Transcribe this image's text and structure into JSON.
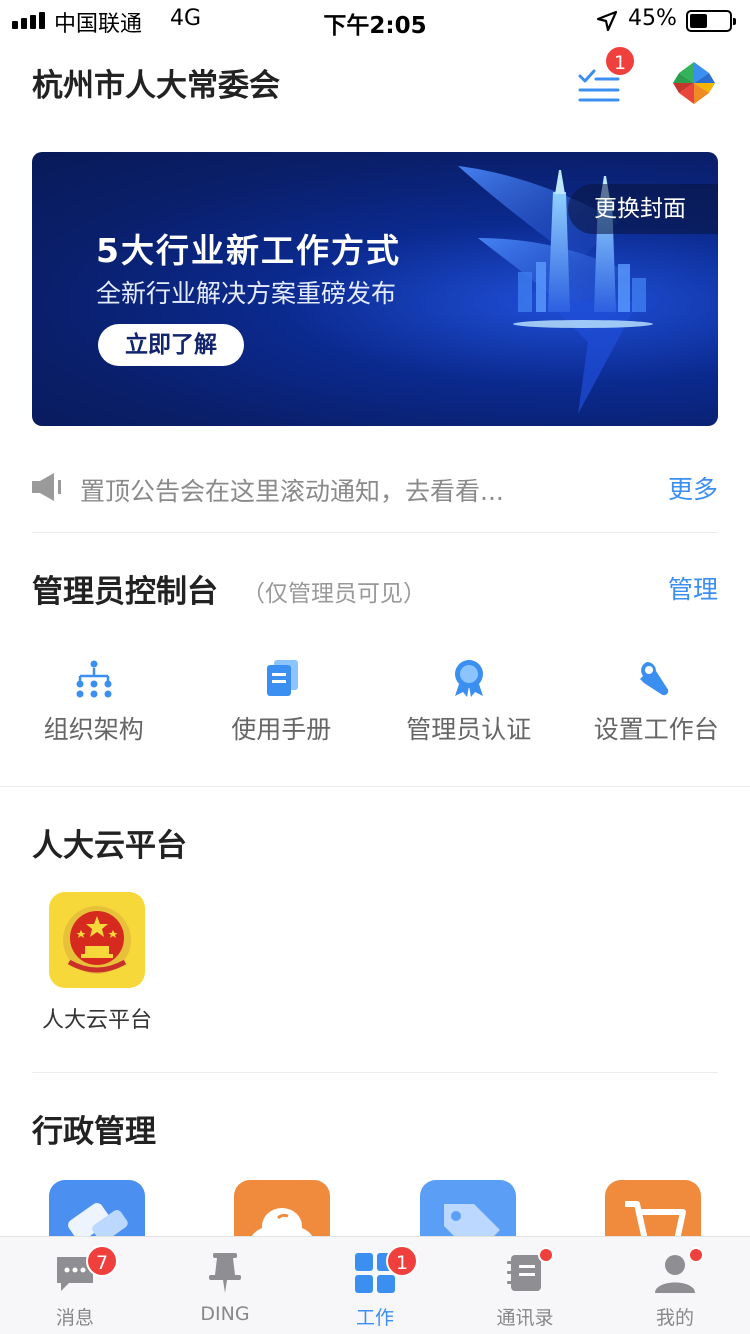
{
  "status_bar": {
    "carrier": "中国联通",
    "network": "4G",
    "time": "下午2:05",
    "battery_percent": "45%",
    "battery_level": 0.45
  },
  "header": {
    "title": "杭州市人大常委会",
    "todo_badge": "1"
  },
  "banner": {
    "title": "5大行业新工作方式",
    "subtitle": "全新行业解决方案重磅发布",
    "cta": "立即了解",
    "change_cover": "更换封面"
  },
  "notice": {
    "text": "置顶公告会在这里滚动通知，去看看...",
    "more": "更多"
  },
  "admin": {
    "title": "管理员控制台",
    "note": "（仅管理员可见）",
    "manage": "管理",
    "tools": [
      {
        "label": "组织架构",
        "icon": "org-chart-icon"
      },
      {
        "label": "使用手册",
        "icon": "manual-icon"
      },
      {
        "label": "管理员认证",
        "icon": "certification-icon"
      },
      {
        "label": "设置工作台",
        "icon": "wrench-icon"
      }
    ]
  },
  "cloud_section": {
    "title": "人大云平台",
    "apps": [
      {
        "label": "人大云平台",
        "icon": "national-emblem-icon"
      }
    ]
  },
  "admin_section": {
    "title": "行政管理"
  },
  "tabbar": {
    "items": [
      {
        "label": "消息",
        "icon": "message-icon",
        "badge": "7"
      },
      {
        "label": "DING",
        "icon": "pin-icon"
      },
      {
        "label": "工作",
        "icon": "grid-icon",
        "badge": "1",
        "active": true
      },
      {
        "label": "通讯录",
        "icon": "contacts-icon"
      },
      {
        "label": "我的",
        "icon": "profile-icon"
      }
    ]
  },
  "colors": {
    "accent": "#3b8ff0",
    "badge": "#f0403d",
    "banner_dark": "#0a1f6b"
  }
}
